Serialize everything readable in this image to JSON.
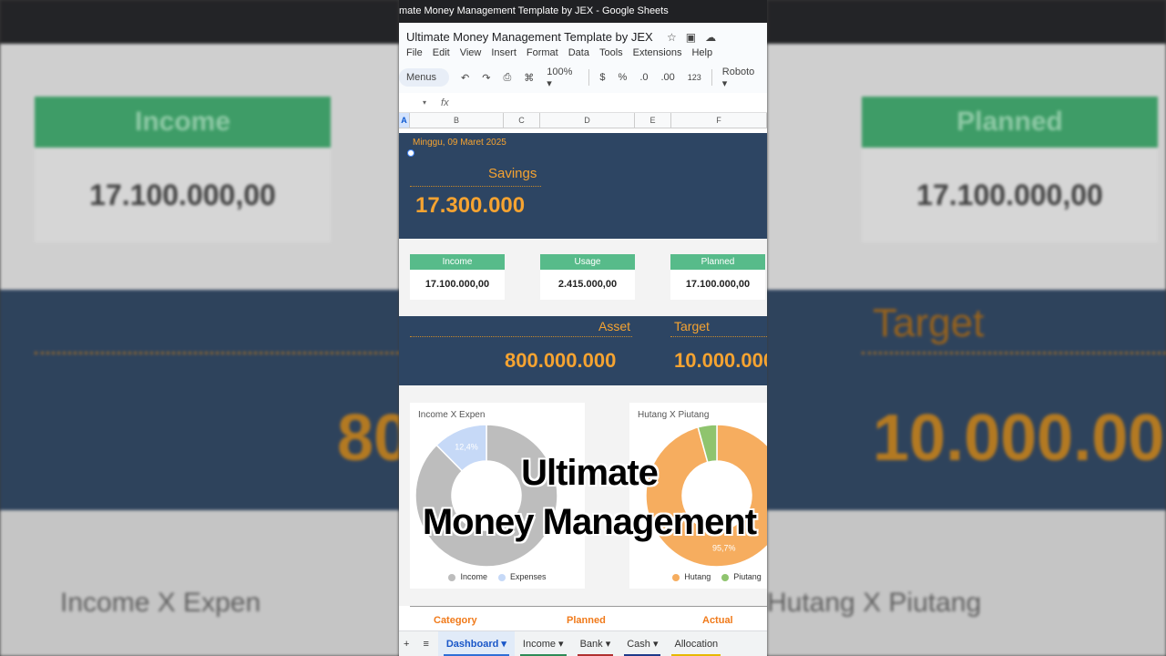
{
  "window": {
    "title": "mate Money Management Template by JEX - Google Sheets"
  },
  "doc": {
    "title": "Ultimate Money Management Template by JEX"
  },
  "menu": [
    "File",
    "Edit",
    "View",
    "Insert",
    "Format",
    "Data",
    "Tools",
    "Extensions",
    "Help"
  ],
  "toolbar": {
    "menus": "Menus",
    "zoom": "100%",
    "currency": "$",
    "percent": "%",
    "dec_less": ".0",
    "dec_more": ".00",
    "format123": "123",
    "font": "Roboto"
  },
  "formula": {
    "fx": "fx"
  },
  "columns": [
    "A",
    "B",
    "C",
    "D",
    "E",
    "F"
  ],
  "dashboard": {
    "date": "Minggu, 09 Maret 2025",
    "savings_label": "Savings",
    "savings_value": "17.300.000",
    "cards": [
      {
        "label": "Income",
        "value": "17.100.000,00"
      },
      {
        "label": "Usage",
        "value": "2.415.000,00"
      },
      {
        "label": "Planned",
        "value": "17.100.000,00"
      }
    ],
    "asset_label": "Asset",
    "asset_value": "800.000.000",
    "target_label": "Target",
    "target_value": "10.000.000",
    "table_headers": [
      "Category",
      "Planned",
      "Actual"
    ]
  },
  "chart_data": [
    {
      "type": "pie",
      "title": "Income X Expen",
      "categories": [
        "Income",
        "Expenses"
      ],
      "values": [
        87.6,
        12.4
      ],
      "labels": [
        "",
        "12,4%"
      ],
      "colors": [
        "#bdbdbd",
        "#c6d9f7"
      ]
    },
    {
      "type": "pie",
      "title": "Hutang X Piutang",
      "categories": [
        "Hutang",
        "Piutang"
      ],
      "values": [
        95.7,
        4.3
      ],
      "labels": [
        "95,7%",
        ""
      ],
      "colors": [
        "#f6ad5f",
        "#8fc46e"
      ]
    }
  ],
  "sheet_tabs": [
    {
      "label": "Dashboard",
      "active": true,
      "color": "#2f6fd6"
    },
    {
      "label": "Income",
      "active": false,
      "color": "#2e8b57"
    },
    {
      "label": "Bank",
      "active": false,
      "color": "#b03030"
    },
    {
      "label": "Cash",
      "active": false,
      "color": "#1e3a8a"
    },
    {
      "label": "Allocation",
      "active": false,
      "color": "#e6b800"
    }
  ],
  "overlay": {
    "line1": "Ultimate",
    "line2": "Money Management"
  },
  "background": {
    "income": "Income",
    "planned": "Planned",
    "income_value": "17.100.000,00",
    "planned_value": "17.100.000,00",
    "target": "Target",
    "big_left": "80",
    "big_right": "10.000.00",
    "chart_left": "Income X Expen",
    "chart_right": "Hutang X Piutang"
  }
}
